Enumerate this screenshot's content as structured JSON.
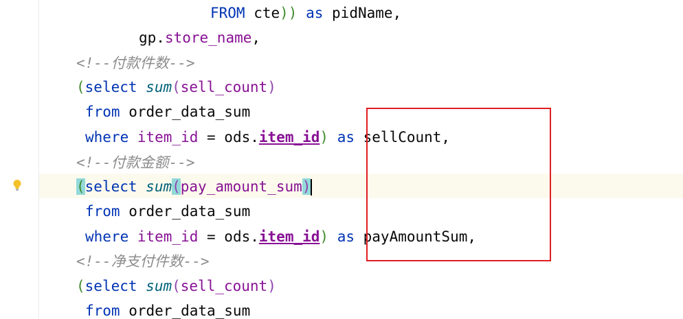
{
  "lines": [
    {
      "parts": [
        {
          "t": "FROM",
          "c": "kw"
        },
        {
          "t": " cte",
          "c": ""
        },
        {
          "t": "))",
          "c": "paren-g"
        },
        {
          "t": " as ",
          "c": "kw"
        },
        {
          "t": "pidName,",
          "c": ""
        }
      ]
    },
    {
      "parts": [
        {
          "t": "gp.",
          "c": ""
        },
        {
          "t": "store_name",
          "c": "field"
        },
        {
          "t": ",",
          "c": ""
        }
      ]
    },
    {
      "parts": [
        {
          "t": "<!--付款件数-->",
          "c": "comment"
        }
      ]
    },
    {
      "parts": [
        {
          "t": "(",
          "c": "paren-g"
        },
        {
          "t": "select ",
          "c": "kw"
        },
        {
          "t": "sum",
          "c": "fn"
        },
        {
          "t": "(",
          "c": "paren-p"
        },
        {
          "t": "sell_count",
          "c": "field"
        },
        {
          "t": ")",
          "c": "paren-p"
        }
      ]
    },
    {
      "parts": [
        {
          "t": "from ",
          "c": "kw"
        },
        {
          "t": "order_data_sum",
          "c": ""
        }
      ]
    },
    {
      "parts": [
        {
          "t": "where ",
          "c": "kw"
        },
        {
          "t": "item_id",
          "c": "field"
        },
        {
          "t": " = ods.",
          "c": ""
        },
        {
          "t": "item_id",
          "c": "field-bold"
        },
        {
          "t": ")",
          "c": "paren-g"
        },
        {
          "t": " as ",
          "c": "kw"
        },
        {
          "t": "sellCount,",
          "c": ""
        }
      ]
    },
    {
      "parts": [
        {
          "t": "<!--付款金额-->",
          "c": "comment"
        }
      ]
    },
    {
      "parts": [
        {
          "t": "(",
          "c": "paren-g paren-hl"
        },
        {
          "t": "select ",
          "c": "kw"
        },
        {
          "t": "sum",
          "c": "fn"
        },
        {
          "t": "(",
          "c": "paren-p paren-hl"
        },
        {
          "t": "pay_amount_sum",
          "c": "field"
        },
        {
          "t": ")",
          "c": "paren-p paren-hl"
        }
      ]
    },
    {
      "parts": [
        {
          "t": "from ",
          "c": "kw"
        },
        {
          "t": "order_data_sum",
          "c": ""
        }
      ]
    },
    {
      "parts": [
        {
          "t": "where ",
          "c": "kw"
        },
        {
          "t": "item_id",
          "c": "field"
        },
        {
          "t": " = ods.",
          "c": ""
        },
        {
          "t": "item_id",
          "c": "field-bold"
        },
        {
          "t": ")",
          "c": "paren-g"
        },
        {
          "t": " as ",
          "c": "kw"
        },
        {
          "t": "payAmountSum,",
          "c": ""
        }
      ]
    },
    {
      "parts": [
        {
          "t": "<!--净支付件数-->",
          "c": "comment"
        }
      ]
    },
    {
      "parts": [
        {
          "t": "(",
          "c": "paren-g"
        },
        {
          "t": "select ",
          "c": "kw"
        },
        {
          "t": "sum",
          "c": "fn"
        },
        {
          "t": "(",
          "c": "paren-p"
        },
        {
          "t": "sell_count",
          "c": "field"
        },
        {
          "t": ")",
          "c": "paren-p"
        }
      ]
    },
    {
      "parts": [
        {
          "t": "from ",
          "c": "kw"
        },
        {
          "t": "order_data_sum",
          "c": ""
        }
      ]
    }
  ],
  "colors": {
    "keyword": "#0033b3",
    "function": "#00627a",
    "field": "#871094",
    "comment": "#8c8c8c",
    "annotation_box": "#e01d22",
    "current_line": "#fcfaed"
  },
  "icons": {
    "gutter": "lightbulb-icon"
  }
}
